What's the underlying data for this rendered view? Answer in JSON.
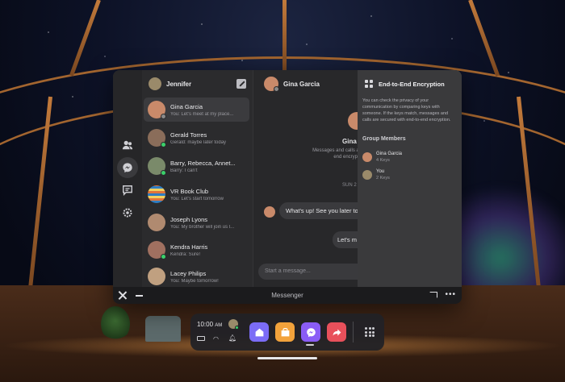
{
  "environment": {
    "colors": {
      "sky": "#0d1227",
      "wood": "#a3652f"
    }
  },
  "window": {
    "title": "Messenger",
    "accent": "#0084ff",
    "rail": {
      "items": [
        {
          "name": "people-icon"
        },
        {
          "name": "messenger-icon",
          "active": true
        },
        {
          "name": "chat-bubble-icon"
        },
        {
          "name": "settings-gear-icon"
        }
      ]
    },
    "conversations_panel": {
      "user": "Jennifer",
      "items": [
        {
          "title": "Gina Garcia",
          "preview": "You: Let's meet at my place...",
          "active": true,
          "color": "#c98a6a"
        },
        {
          "title": "Gerald Torres",
          "preview": "Gerald: maybe later today",
          "color": "#8a6d5a"
        },
        {
          "title": "Barry, Rebecca, Annet...",
          "preview": "Barry: I can't",
          "color": "#7a8a6a"
        },
        {
          "title": "VR Book Club",
          "preview": "You: Let's start tomorrow",
          "color": "#2e7dc2"
        },
        {
          "title": "Joseph Lyons",
          "preview": "You: My brother will join us l...",
          "color": "#b08a70"
        },
        {
          "title": "Kendra Harris",
          "preview": "Kendra: Sure!",
          "color": "#a07060"
        },
        {
          "title": "Lacey Philips",
          "preview": "You: Maybe tomorrow!",
          "color": "#c0a080"
        }
      ]
    },
    "chat": {
      "contact": "Gina Garcia",
      "intro_name": "Gina G",
      "intro_text": "Messages and calls are end-to-end encrypt",
      "date_separator": "SUN 2",
      "incoming_message": "What's up! See you later tod",
      "outgoing_message": "Let's m head ov",
      "composer_placeholder": "Start a message..."
    },
    "encryption_panel": {
      "title": "End-to-End Encryption",
      "description": "You can check the privacy of your communication by comparing keys with someone. If the keys match, messages and calls are secured with end-to-end encryption.",
      "group_title": "Group Members",
      "members": [
        {
          "name": "Gina Garcia",
          "keys": "4 Keys"
        },
        {
          "name": "You",
          "keys": "2 Keys"
        }
      ]
    }
  },
  "dock": {
    "time": "10:00",
    "am_pm": "AM",
    "apps": [
      {
        "name": "home-app-icon",
        "color": "#7b6cf6"
      },
      {
        "name": "store-app-icon",
        "color": "#f2a23b"
      },
      {
        "name": "messenger-app-icon",
        "color": "#8a5cf6",
        "active": true
      },
      {
        "name": "share-app-icon",
        "color": "#e8505b"
      }
    ]
  }
}
